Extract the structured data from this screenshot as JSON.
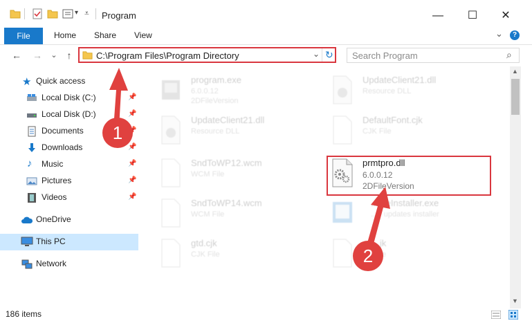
{
  "window": {
    "title": "Program",
    "minimize_glyph": "—",
    "maximize_glyph": "☐",
    "close_glyph": "✕"
  },
  "ribbon": {
    "file_label": "File",
    "tabs": [
      "Home",
      "Share",
      "View"
    ],
    "expand_glyph": "⌄",
    "help_glyph": "?"
  },
  "nav": {
    "back_glyph": "←",
    "forward_glyph": "→",
    "recent_glyph": "⌄",
    "up_glyph": "↑",
    "address": "C:\\Program Files\\Program Directory",
    "dropdown_glyph": "⌄",
    "refresh_glyph": "↻",
    "search_placeholder": "Search Program",
    "search_glyph": "⌕"
  },
  "sidebar": {
    "pin_glyph": "📌",
    "items": [
      {
        "label": "Quick access"
      },
      {
        "label": "Local Disk (C:)"
      },
      {
        "label": "Local Disk (D:)"
      },
      {
        "label": "Documents"
      },
      {
        "label": "Downloads"
      },
      {
        "label": "Music"
      },
      {
        "label": "Pictures"
      },
      {
        "label": "Videos"
      },
      {
        "label": "OneDrive"
      },
      {
        "label": "This PC"
      },
      {
        "label": "Network"
      }
    ]
  },
  "files": [
    {
      "name": "program.exe",
      "line1": "6.0.0.12",
      "line2": "2DFileVersion"
    },
    {
      "name": "UpdateClient21.dll",
      "line1": "Resource DLL",
      "line2": ""
    },
    {
      "name": "UpdateClient21.dll",
      "line1": "Resource DLL",
      "line2": ""
    },
    {
      "name": "DefaultFont.cjk",
      "line1": "CJK File",
      "line2": ""
    },
    {
      "name": "SndToWP12.wcm",
      "line1": "WCM File",
      "line2": ""
    },
    {
      "name": "prmtpro.dll",
      "line1": "6.0.0.12",
      "line2": "2DFileVersion"
    },
    {
      "name": "SndToWP14.wcm",
      "line1": "WCM File",
      "line2": ""
    },
    {
      "name": "...ateInstaller.exe",
      "line1": "...T updates installer",
      "line2": ""
    },
    {
      "name": "gtd.cjk",
      "line1": "CJK File",
      "line2": ""
    },
    {
      "name": "...jk",
      "line1": "...ile",
      "line2": ""
    }
  ],
  "scrollbar": {
    "up_glyph": "▲",
    "down_glyph": "▼"
  },
  "status": {
    "count": "186 items"
  },
  "annotations": {
    "badge1": "1",
    "badge2": "2"
  },
  "colors": {
    "accent": "#1979ca",
    "highlight": "#d9363e",
    "selection": "#cce8ff"
  }
}
